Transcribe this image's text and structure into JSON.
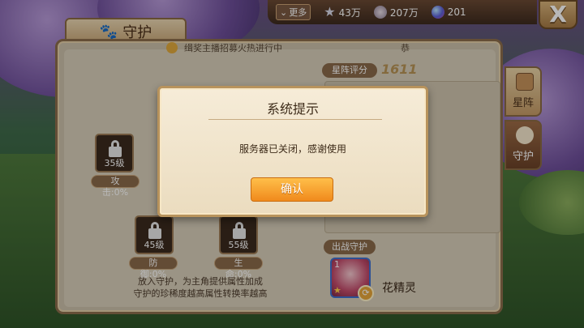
{
  "topbar": {
    "more_label": "更多",
    "stars": "43万",
    "shells": "207万",
    "orbs": "201"
  },
  "close": {
    "label": "X"
  },
  "panel": {
    "title": "守护",
    "banner_left": "缉奖主播招募火热进行中",
    "banner_right": "恭"
  },
  "slots": [
    {
      "level": "35级",
      "label": "攻击:0%"
    },
    {
      "level": "45级",
      "label": "防御:0%"
    },
    {
      "level": "55级",
      "label": "生命:0%"
    }
  ],
  "hint": "放入守护，为主角提供属性加成\n守护的珍稀度越高属性转换率越高",
  "formation": {
    "rating_label": "星阵评分",
    "rating_value": "1611"
  },
  "out_guard": {
    "label": "出战守护",
    "level": "1",
    "name": "花精灵"
  },
  "side_tabs": [
    {
      "label": "星阵",
      "icon": "scroll-icon"
    },
    {
      "label": "守护",
      "icon": "guard-spirit-icon"
    }
  ],
  "dialog": {
    "title": "系统提示",
    "message": "服务器已关闭，感谢使用",
    "confirm": "确认"
  }
}
